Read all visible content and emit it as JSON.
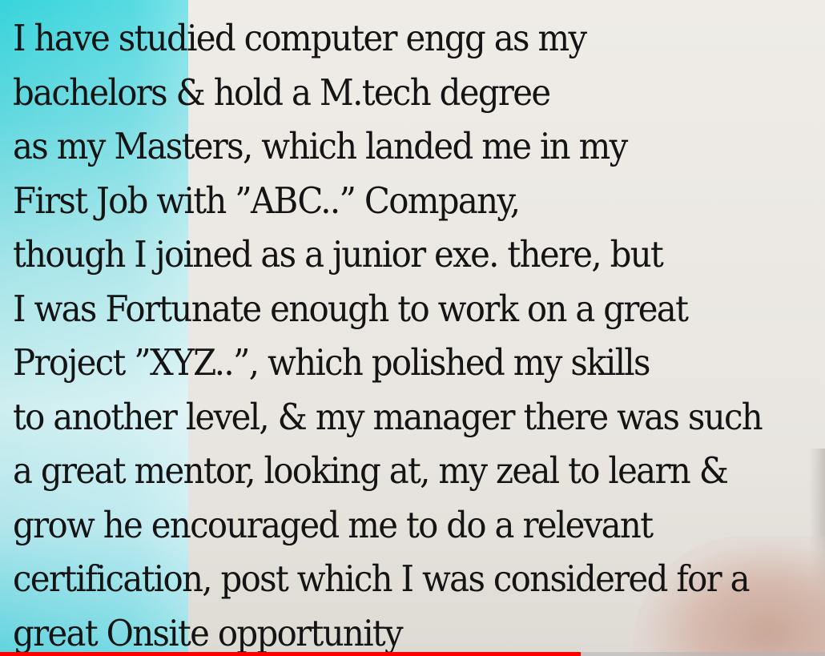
{
  "caption_lines": [
    "I have studied computer engg as my",
    "bachelors & hold a M.tech degree",
    "as my Masters, which landed me in my",
    "First Job with ”ABC..” Company,",
    "though I joined as a junior exe. there, but",
    "I was Fortunate enough to work on a great",
    "Project ”XYZ..”, which polished my skills",
    "to another level, & my manager there was such",
    "a great mentor, looking at, my zeal to learn &",
    "grow he encouraged me to do a relevant",
    "certification, post which I was considered for a",
    "great Onsite opportunity"
  ],
  "player": {
    "progress_fraction": 0.704,
    "progress_color": "#ff0000"
  },
  "colors": {
    "text": "#141414",
    "left_panel": "#62d8df",
    "background": "#ebe8e3"
  }
}
